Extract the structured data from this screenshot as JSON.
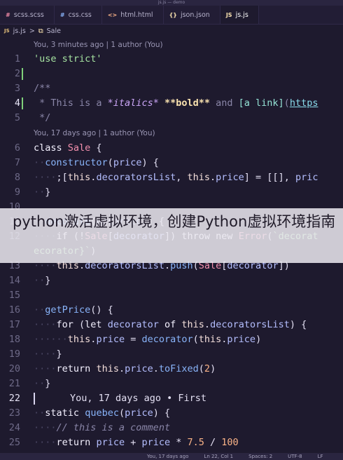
{
  "window": {
    "title": "js.js — demo"
  },
  "tabs": [
    {
      "icon": "#",
      "label": "scss.scss"
    },
    {
      "icon": "#",
      "label": "css.css"
    },
    {
      "icon": "<>",
      "label": "html.html"
    },
    {
      "icon": "{}",
      "label": "json.json"
    },
    {
      "icon": "JS",
      "label": "js.js"
    }
  ],
  "breadcrumb": {
    "icon": "JS",
    "file": "js.js",
    "separator": ">",
    "symbol_icon": "⧉",
    "symbol": "Sale"
  },
  "lenses": {
    "l1": "You, 3 minutes ago | 1 author (You)",
    "l6": "You, 17 days ago | 1 author (You)"
  },
  "line_numbers": [
    "1",
    "2",
    "3",
    "4",
    "5",
    "6",
    "7",
    "8",
    "9",
    "10",
    "11",
    "12",
    "13",
    "14",
    "15",
    "16",
    "17",
    "18",
    "19",
    "20",
    "21",
    "22",
    "23",
    "24",
    "25"
  ],
  "inline_blame": "You, 17 days ago • First",
  "overlay": {
    "text": "python激活虚拟环境，创建Python虚拟环境指南"
  },
  "statusbar": {
    "blame": "You, 17 days ago",
    "position": "Ln 22, Col 1",
    "spaces": "Spaces: 2",
    "encoding": "UTF-8",
    "eol": "LF"
  },
  "colors": {
    "background": "#1e1a2e",
    "gutter_added": "#7fd07a",
    "string": "#a6e3a1",
    "class": "#f28fad"
  }
}
